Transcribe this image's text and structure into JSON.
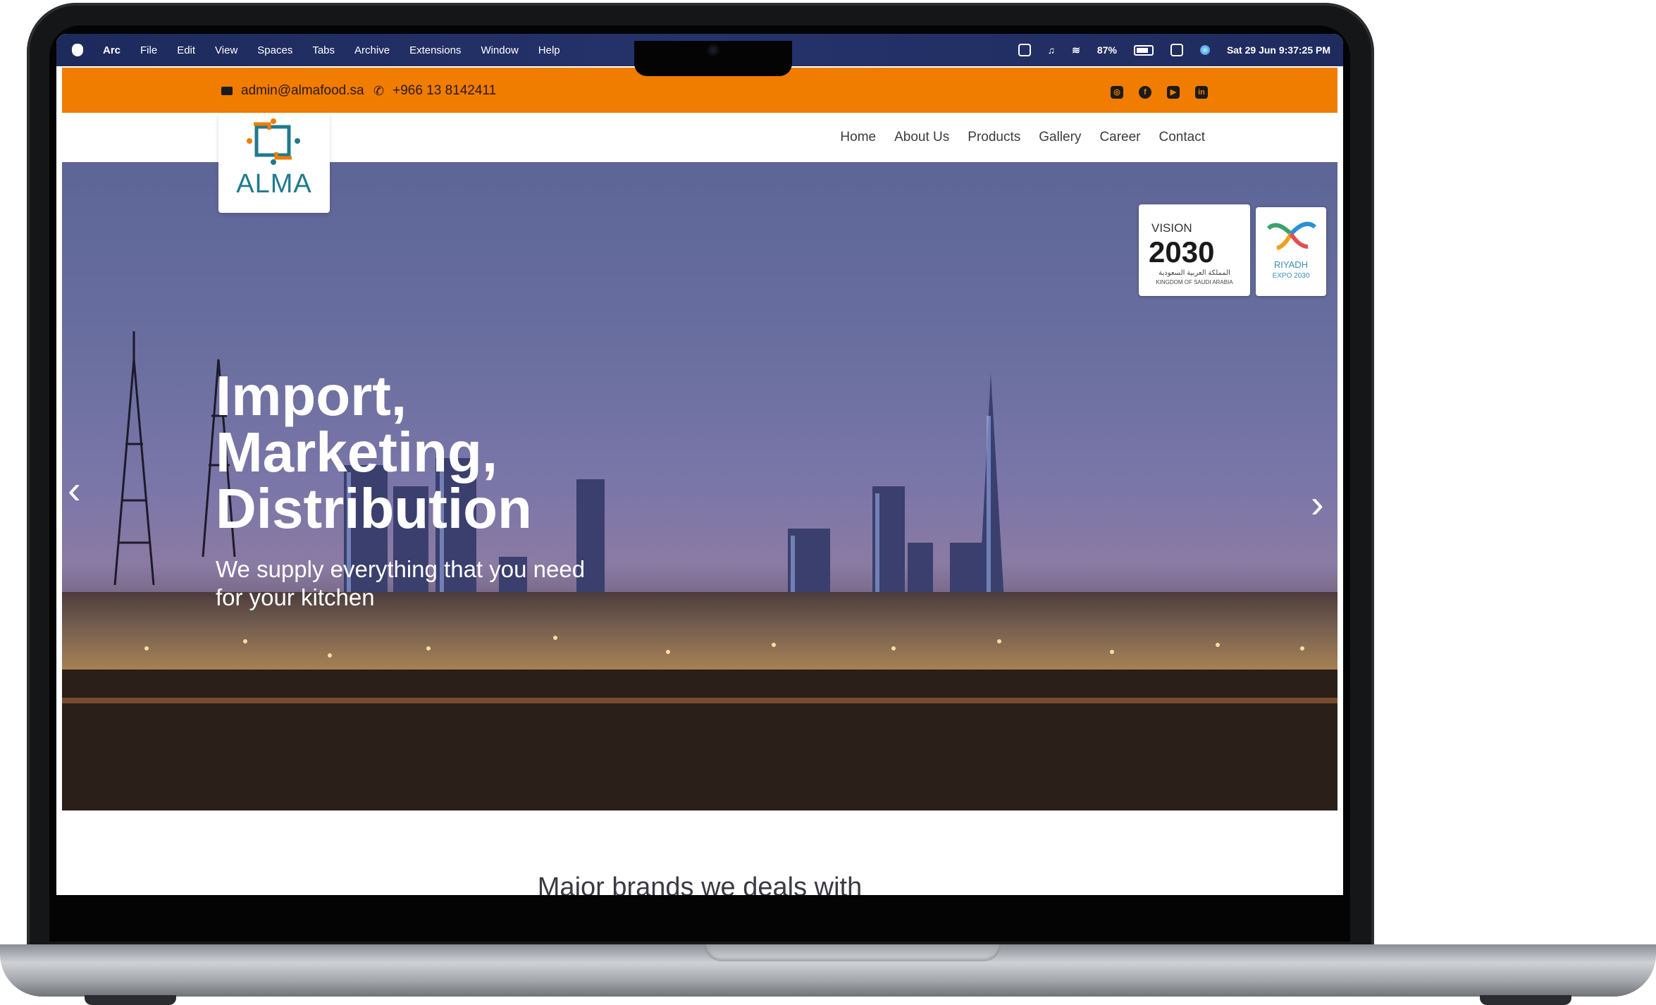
{
  "menubar": {
    "app": "Arc",
    "menus": [
      "File",
      "Edit",
      "View",
      "Spaces",
      "Tabs",
      "Archive",
      "Extensions",
      "Window",
      "Help"
    ],
    "battery": "87%",
    "datetime": "Sat 29 Jun  9:37:25 PM"
  },
  "topbar": {
    "email": "admin@almafood.sa",
    "phone": "+966 13 8142411",
    "social": [
      "instagram-icon",
      "facebook-icon",
      "youtube-icon",
      "linkedin-icon"
    ]
  },
  "logo": {
    "text": "ALMA"
  },
  "nav": {
    "links": [
      "Home",
      "About Us",
      "Products",
      "Gallery",
      "Career",
      "Contact"
    ]
  },
  "hero": {
    "title": "Import,\nMarketing,\nDistribution",
    "subtitle": "We supply everything that you need for your kitchen"
  },
  "badges": {
    "vision_top": "VISION",
    "vision_number": "2030",
    "vision_arabic": "المملكة العربية السعودية",
    "vision_country": "KINGDOM OF SAUDI ARABIA",
    "expo_name": "RIYADH",
    "expo_year": "EXPO 2030"
  },
  "section": {
    "heading": "Major brands we deals with"
  },
  "colors": {
    "accent": "#f07c00",
    "logo_teal": "#1f7a8c",
    "menubar": "#25336b"
  }
}
